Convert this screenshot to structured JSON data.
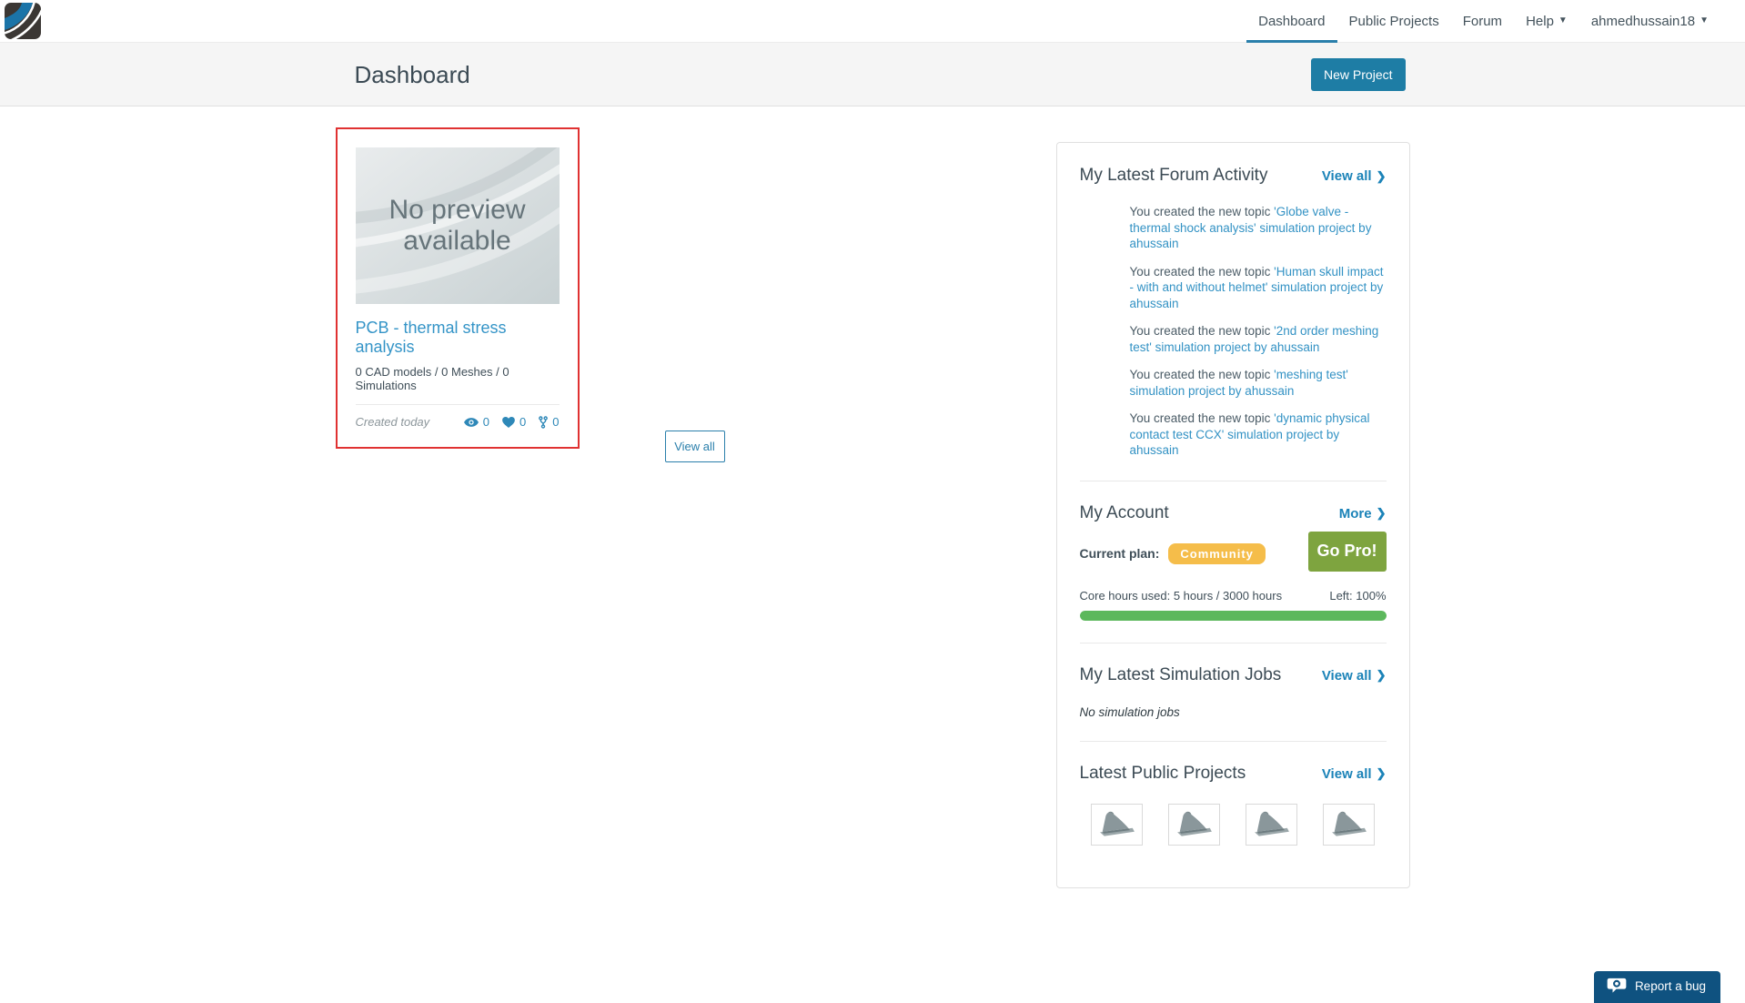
{
  "topnav": {
    "items": [
      "Dashboard",
      "Public Projects",
      "Forum",
      "Help"
    ],
    "user": "ahmedhussain18"
  },
  "header": {
    "title": "Dashboard",
    "new_project_label": "New Project"
  },
  "project_card": {
    "no_preview": "No preview available",
    "title": "PCB - thermal stress analysis",
    "stats": "0 CAD models / 0 Meshes / 0 Simulations",
    "created": "Created today",
    "views": "0",
    "likes": "0",
    "forks": "0"
  },
  "view_all_button": "View all",
  "forum_activity": {
    "title": "My Latest Forum Activity",
    "view_all": "View all",
    "items": [
      {
        "prefix": "You created the new topic ",
        "link": "'Globe valve - thermal shock analysis' simulation project by ahussain"
      },
      {
        "prefix": "You created the new topic ",
        "link": "'Human skull impact - with and without helmet' simulation project by ahussain"
      },
      {
        "prefix": "You created the new topic ",
        "link": "'2nd order meshing test' simulation project by ahussain"
      },
      {
        "prefix": "You created the new topic ",
        "link": "'meshing test' simulation project by ahussain"
      },
      {
        "prefix": "You created the new topic ",
        "link": "'dynamic physical contact test CCX' simulation project by ahussain"
      }
    ]
  },
  "account": {
    "title": "My Account",
    "more": "More",
    "plan_label": "Current plan:",
    "plan": "Community",
    "go_pro": "Go Pro!",
    "core_hours": "Core hours used: 5 hours / 3000 hours",
    "left": "Left: 100%",
    "progress_pct": 100
  },
  "simulation_jobs": {
    "title": "My Latest Simulation Jobs",
    "view_all": "View all",
    "empty": "No simulation jobs"
  },
  "public_projects": {
    "title": "Latest Public Projects",
    "view_all": "View all"
  },
  "report_bug": "Report a bug",
  "colors": {
    "accent_blue": "#1b83b8",
    "button_blue": "#1e7da5",
    "selection_red": "#e03232",
    "badge_amber": "#f5bd4a",
    "gopro_green": "#7ea43f",
    "progress_green": "#5cb85c",
    "report_bug_blue": "#0f5280"
  }
}
